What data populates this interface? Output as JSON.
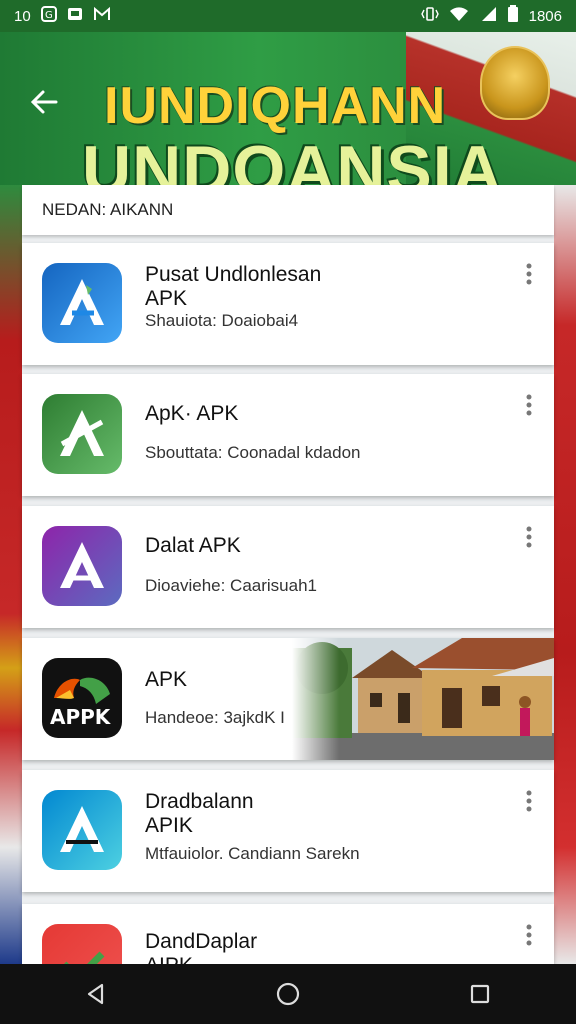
{
  "status_bar": {
    "left_text": "10",
    "time": "1806",
    "icons": [
      "g-icon",
      "image-icon",
      "gmail-icon",
      "vibrate-icon",
      "wifi-icon",
      "signal-icon",
      "battery-icon"
    ]
  },
  "header": {
    "title_line1": "IUNDIQHANN",
    "title_line2": "UNDOANSIA",
    "back_icon": "arrow-back-icon",
    "colors": {
      "green": "#2c8f3f",
      "yellow": "#ffd23a"
    }
  },
  "subheader": {
    "text": "NEDAN: AIKANN"
  },
  "apps": [
    {
      "name": "Pusat Undlonlesan",
      "name2": "APK",
      "subtitle": "Shauiota: Doaiobai4",
      "icon": "a-logo-blue-icon",
      "icon_colors": [
        "#1565c0",
        "#42a5f5"
      ]
    },
    {
      "name": "ApK· APK",
      "name2": "",
      "subtitle": "Sbouttata: Coonadal kdadon",
      "icon": "a-logo-green-icon",
      "icon_colors": [
        "#2e7d32",
        "#66bb6a"
      ]
    },
    {
      "name": "Dalat APK",
      "name2": "",
      "subtitle": "Dioaviehe: Caarisuah1",
      "icon": "a-logo-purple-icon",
      "icon_colors": [
        "#6a1b9a",
        "#5c6bc0"
      ]
    },
    {
      "name": "APK",
      "name2": "",
      "subtitle": "Handeoe: 3ajkdK I",
      "icon": "appk-logo-black-icon",
      "icon_label": "APPK",
      "icon_colors": [
        "#111111",
        "#4caf50"
      ]
    },
    {
      "name": "Dradbalann",
      "name2": "APIK",
      "subtitle": "Mtfauiolor. Candiann Sarekn",
      "icon": "a-logo-cyan-icon",
      "icon_colors": [
        "#0288d1",
        "#4dd0e1"
      ]
    },
    {
      "name": "DandDaplar",
      "name2": "AIPK",
      "subtitle": "",
      "icon": "a-logo-red-icon",
      "icon_colors": [
        "#e53935",
        "#43a047"
      ]
    }
  ],
  "navigation": {
    "back": "triangle-back-icon",
    "home": "circle-home-icon",
    "recents": "square-recents-icon"
  }
}
